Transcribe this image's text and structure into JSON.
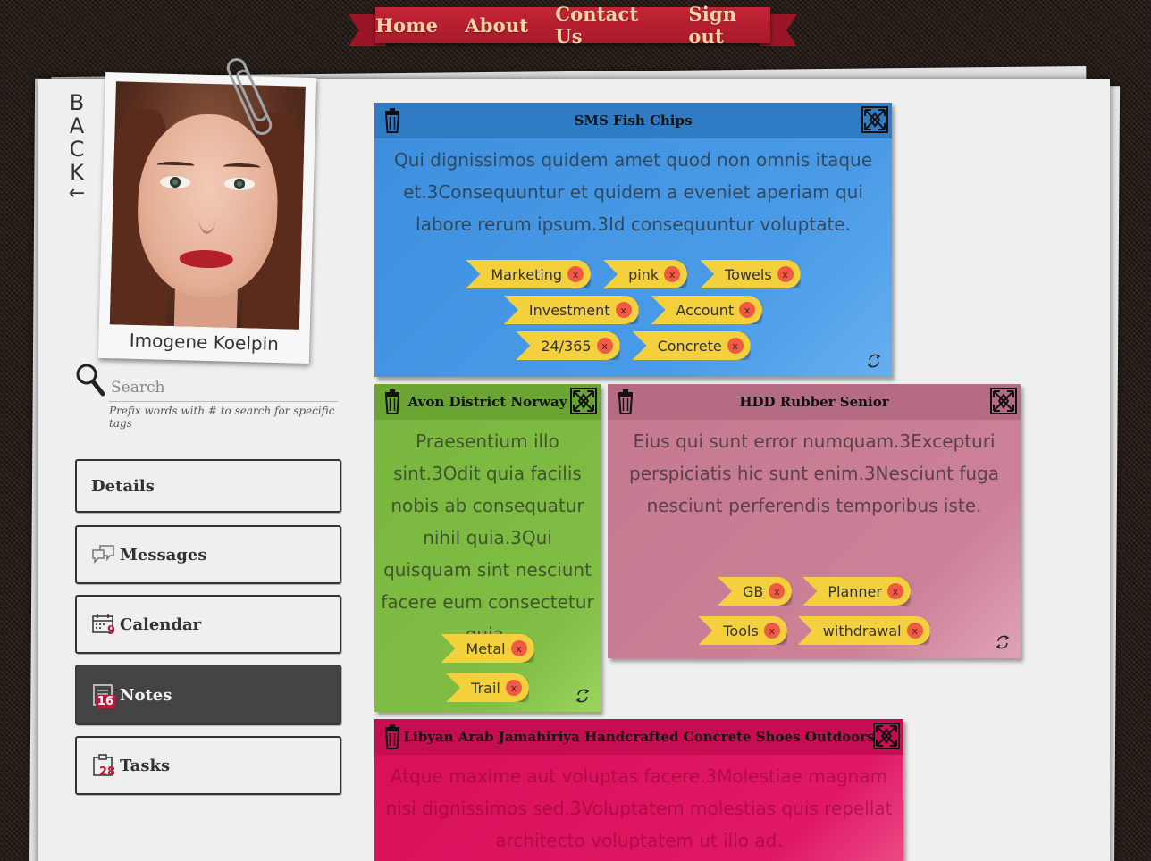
{
  "nav": {
    "items": [
      {
        "label": "Home"
      },
      {
        "label": "About"
      },
      {
        "label": "Contact Us"
      },
      {
        "label": "Sign out"
      }
    ]
  },
  "colors": {
    "ribbon": "#c42436",
    "blue_note": "#4a9be7",
    "green_note": "#80bd44",
    "pink_note": "#cc8198",
    "magenta_note": "#e01864",
    "tag": "#f3d03c",
    "active_menu": "#444444",
    "badge": "#c4183f"
  },
  "profile": {
    "back_letters": [
      "B",
      "A",
      "C",
      "K"
    ],
    "back_arrow": "←",
    "name": "Imogene Koelpin"
  },
  "search": {
    "placeholder": "Search",
    "hint": "Prefix words with # to search for specific tags"
  },
  "menu": {
    "items": [
      {
        "label": "Details",
        "icon": "none",
        "active": false
      },
      {
        "label": "Messages",
        "icon": "speech-bubbles-icon",
        "active": false
      },
      {
        "label": "Calendar",
        "icon": "calendar-icon",
        "badge": "9",
        "active": false
      },
      {
        "label": "Notes",
        "icon": "notebook-icon",
        "badge": "16",
        "active": true
      },
      {
        "label": "Tasks",
        "icon": "clipboard-icon",
        "badge": "28",
        "active": false
      }
    ]
  },
  "notes": [
    {
      "title": "SMS Fish Chips",
      "body": "Qui dignissimos quidem amet quod non omnis itaque et.3Consequuntur et quidem a eveniet aperiam qui labore rerum ipsum.3Id consequuntur voluptate.",
      "tags": [
        "Marketing",
        "pink",
        "Towels",
        "Investment",
        "Account",
        "24/365",
        "Concrete"
      ],
      "color": "blue"
    },
    {
      "title": "Avon District Norway",
      "body": "Praesentium illo sint.3Odit quia facilis nobis ab consequatur nihil quia.3Qui quisquam sint nesciunt facere eum consectetur quia.",
      "tags": [
        "Metal",
        "Trail"
      ],
      "color": "green"
    },
    {
      "title": "HDD Rubber Senior",
      "body": "Eius qui sunt error numquam.3Excepturi perspiciatis hic sunt enim.3Nesciunt fuga nesciunt perferendis temporibus iste.",
      "tags": [
        "GB",
        "Planner",
        "Tools",
        "withdrawal"
      ],
      "color": "pink"
    },
    {
      "title": "Libyan Arab Jamahiriya Handcrafted Concrete Shoes Outdoors",
      "body": "Atque maxime aut voluptas facere.3Molestiae magnam nisi dignissimos sed.3Voluptatem molestias quis repellat architecto voluptatem ut illo ad.",
      "tags": [],
      "color": "magenta"
    }
  ],
  "tag_remove_label": "x"
}
